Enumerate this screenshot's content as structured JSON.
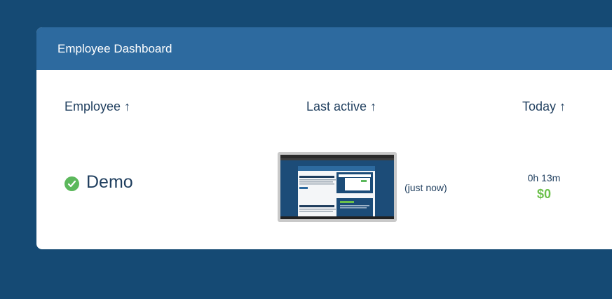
{
  "header": {
    "title": "Employee Dashboard"
  },
  "columns": {
    "employee": "Employee ↑",
    "last_active": "Last active ↑",
    "today": "Today ↑"
  },
  "rows": [
    {
      "name": "Demo",
      "status": "online",
      "last_active": "(just now)",
      "today_time": "0h 13m",
      "today_amount": "$0"
    }
  ],
  "colors": {
    "background": "#154a74",
    "header": "#2d6a9f",
    "text": "#1f3e5e",
    "status_green": "#5cb85c",
    "money_green": "#6cc04a"
  }
}
